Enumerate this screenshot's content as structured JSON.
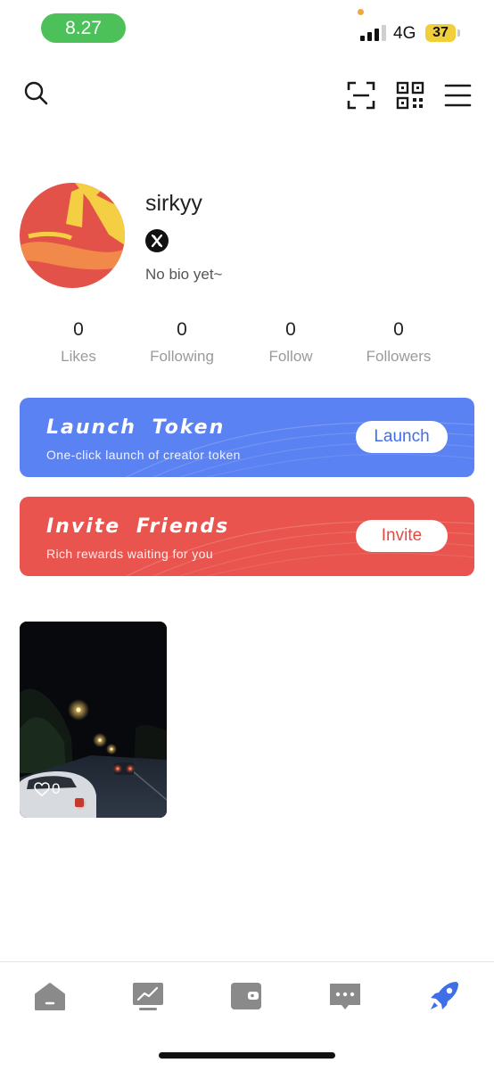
{
  "status_bar": {
    "time": "8.27",
    "network": "4G",
    "battery": "37"
  },
  "toolbar": {
    "icons": [
      "search-icon",
      "scan-icon",
      "qr-code-icon",
      "menu-icon"
    ]
  },
  "profile": {
    "username": "sirkyy",
    "social_icon": "x-logo-icon",
    "bio": "No bio yet~"
  },
  "stats": [
    {
      "value": "0",
      "label": "Likes"
    },
    {
      "value": "0",
      "label": "Following"
    },
    {
      "value": "0",
      "label": "Follow"
    },
    {
      "value": "0",
      "label": "Followers"
    }
  ],
  "banners": {
    "launch": {
      "title": "Launch Token",
      "subtitle": "One-click launch of creator token",
      "button": "Launch",
      "color": "#5b82f2"
    },
    "invite": {
      "title": "Invite Friends",
      "subtitle": "Rich rewards waiting for you",
      "button": "Invite",
      "color": "#e9544e"
    }
  },
  "videos": [
    {
      "likes": "0"
    }
  ],
  "bottom_nav": {
    "items": [
      "home-icon",
      "market-icon",
      "wallet-icon",
      "messages-icon",
      "rocket-icon"
    ],
    "active": "rocket-icon",
    "active_color": "#3f6fe6",
    "inactive_color": "#8a8a8a"
  }
}
